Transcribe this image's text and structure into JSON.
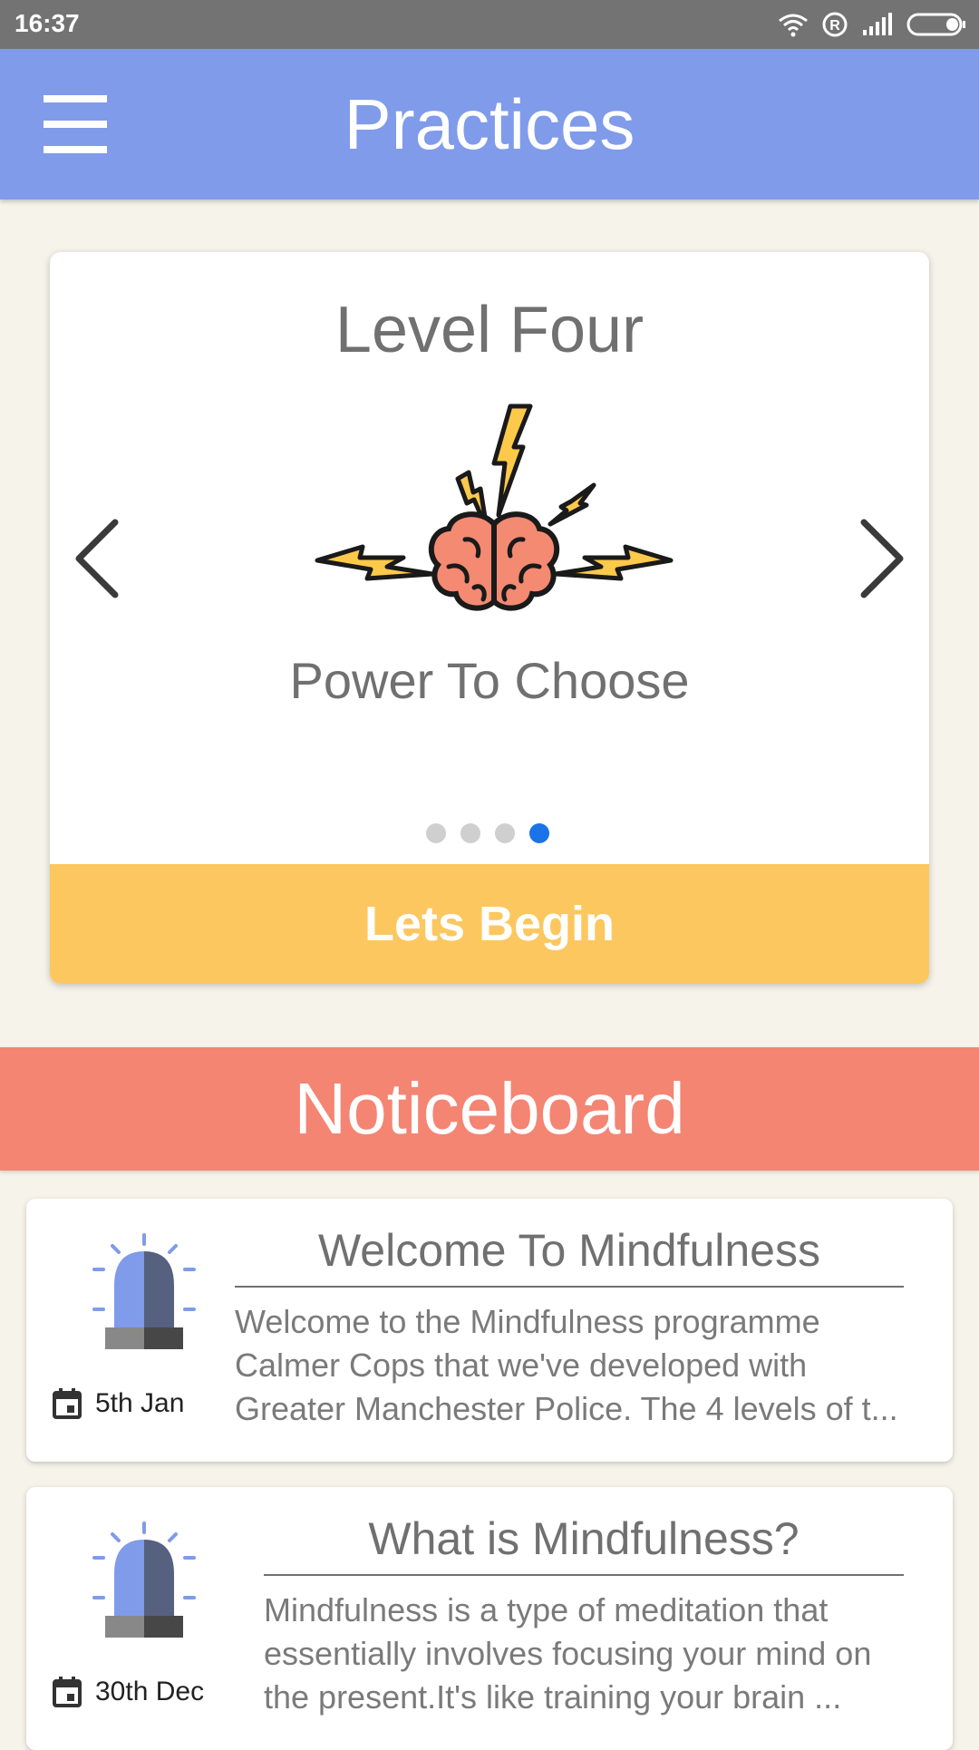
{
  "status_bar": {
    "time": "16:37"
  },
  "app_bar": {
    "title": "Practices"
  },
  "level_card": {
    "title": "Level Four",
    "practice_name": "Power To Choose",
    "carousel_page": 4,
    "carousel_total": 4,
    "button_label": "Lets Begin"
  },
  "noticeboard": {
    "header": "Noticeboard",
    "items": [
      {
        "title": "Welcome To Mindfulness",
        "body": "Welcome to the Mindfulness programme Calmer Cops that we've developed with Greater Manchester Police. The 4 levels of t...",
        "date": "5th Jan",
        "icon": "siren-icon"
      },
      {
        "title": "What is Mindfulness?",
        "body": "Mindfulness is a type of meditation that essentially involves focusing your mind on the present.It's like training your brain ...",
        "date": "30th Dec",
        "icon": "siren-icon"
      }
    ]
  },
  "colors": {
    "app_bar": "#7f9bea",
    "begin_button": "#fcc75f",
    "noticeboard": "#f48573",
    "background": "#f6f3ea",
    "active_dot": "#1a73e8"
  }
}
